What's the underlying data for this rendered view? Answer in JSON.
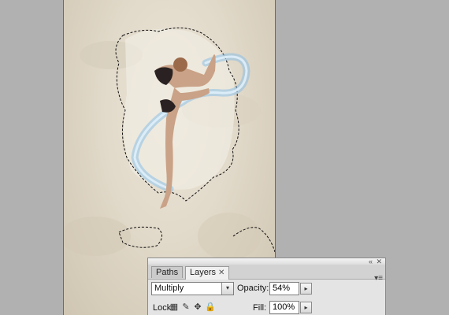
{
  "panel": {
    "tabs": [
      {
        "label": "Paths"
      },
      {
        "label": "Layers",
        "close": "✕"
      }
    ],
    "blend_mode": "Multiply",
    "opacity_label": "Opacity:",
    "opacity_value": "54%",
    "lock_label": "Lock:",
    "fill_label": "Fill:",
    "fill_value": "100%",
    "controls": {
      "collapse": "«",
      "close": "✕",
      "menu": "▾≡"
    }
  },
  "icons": {
    "arrow": "▸",
    "dropdown": "▾",
    "lock_pixels": "▦",
    "lock_brush": "✎",
    "lock_move": "✥",
    "lock_all": "🔒"
  },
  "colors": {
    "workspace": "#b1b1b1",
    "canvas": "#e1d9c9",
    "splash": "#7fb4dc"
  }
}
